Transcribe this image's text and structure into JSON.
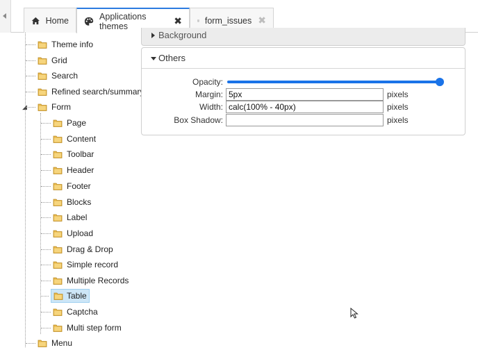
{
  "tabs": [
    {
      "label": "Home",
      "icon": "home-icon",
      "closable": false
    },
    {
      "label": "Applications themes",
      "icon": "palette-icon",
      "closable": true,
      "active": true
    },
    {
      "label": "form_issues",
      "icon": "form-icon",
      "closable": true,
      "active": false
    }
  ],
  "tree": {
    "root_items": [
      "Theme info",
      "Grid",
      "Search",
      "Refined search/summary",
      "Form"
    ],
    "form_children": [
      "Page",
      "Content",
      "Toolbar",
      "Header",
      "Footer",
      "Blocks",
      "Label",
      "Upload",
      "Drag & Drop",
      "Simple record",
      "Multiple Records",
      "Table",
      "Captcha",
      "Multi step form"
    ],
    "after_form": [
      "Menu"
    ],
    "selected": "Table"
  },
  "panels": {
    "background_title": "Background",
    "others_title": "Others",
    "fields": {
      "opacity_label": "Opacity:",
      "opacity_value": 1,
      "margin_label": "Margin:",
      "margin_value": "5px",
      "width_label": "Width:",
      "width_value": "calc(100% - 40px)",
      "box_shadow_label": "Box Shadow:",
      "box_shadow_value": "",
      "unit": "pixels"
    }
  },
  "colors": {
    "accent": "#1a73e8",
    "active_tab_border": "#2c7be0",
    "selection_bg": "#cde6f7",
    "folder": "#e8b84a"
  }
}
